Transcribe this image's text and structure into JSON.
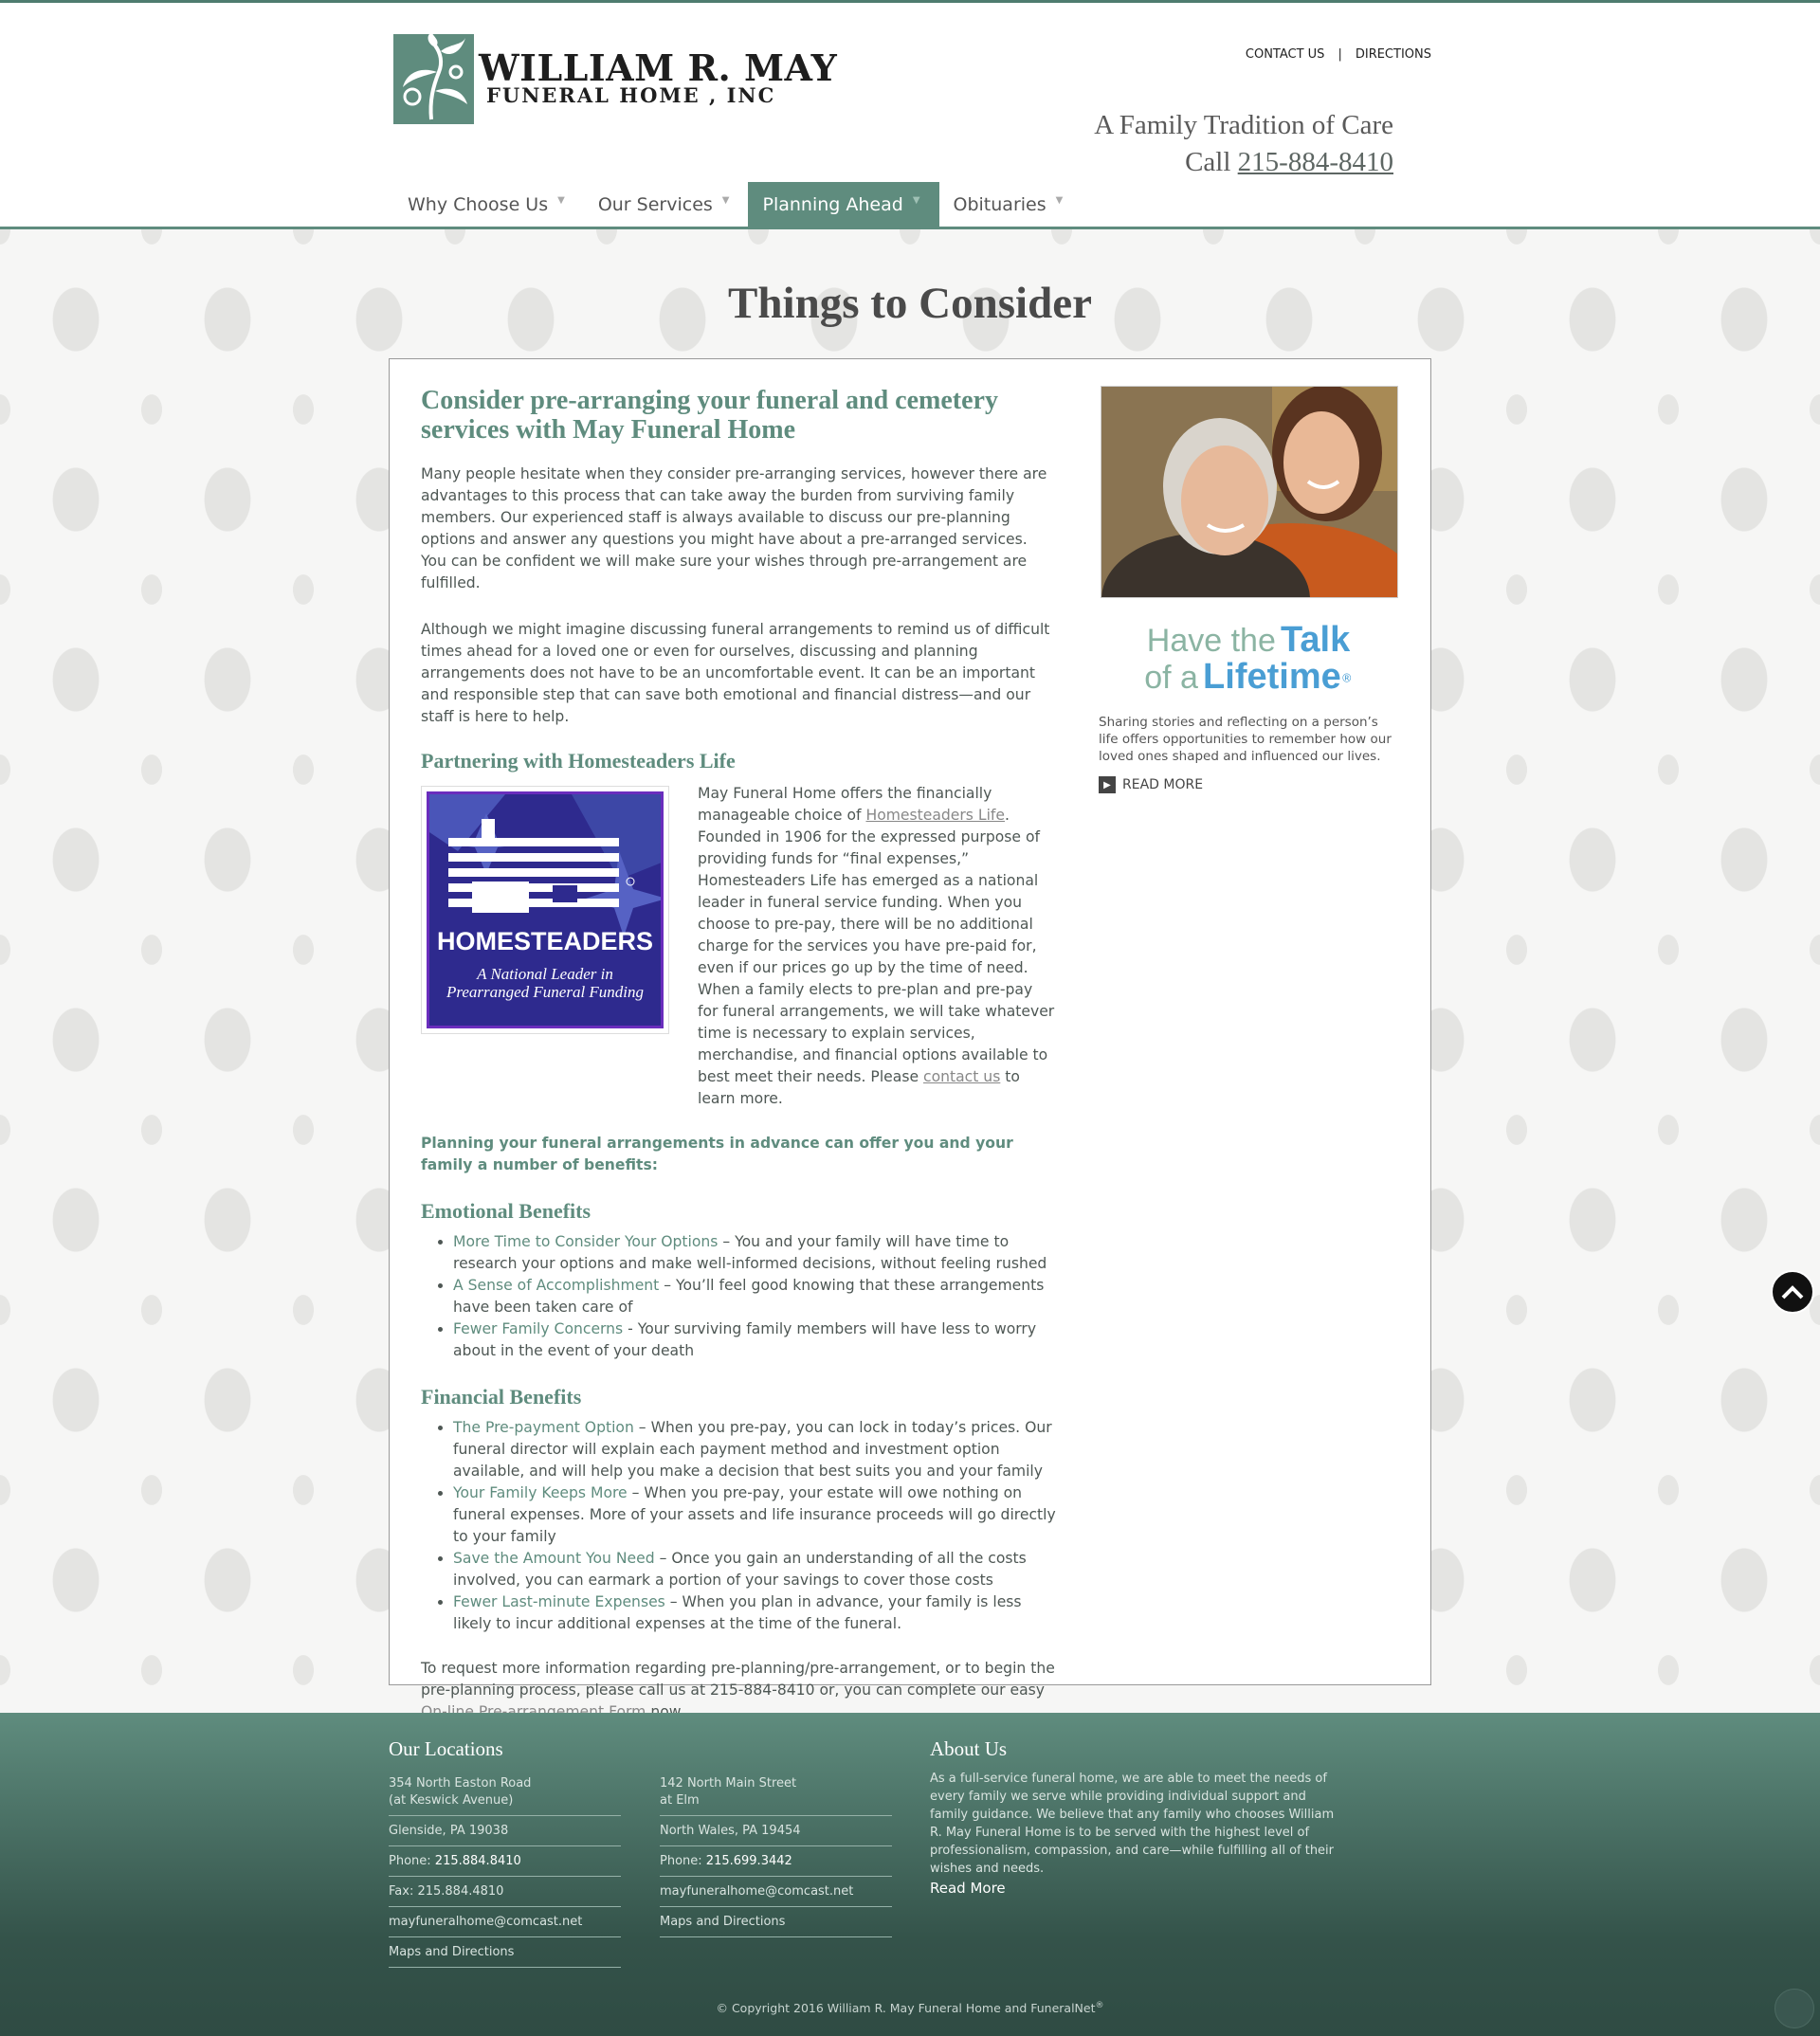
{
  "header": {
    "logo_line1": "WILLIAM R. MAY",
    "logo_line2": "FUNERAL HOME , INC",
    "toplinks": [
      "CONTACT US",
      "DIRECTIONS"
    ],
    "toplink_separator": "|",
    "tagline": "A Family Tradition of Care",
    "call_label": "Call",
    "phone": "215-884-8410"
  },
  "nav": {
    "items": [
      {
        "label": "Why Choose Us",
        "active": false
      },
      {
        "label": "Our Services",
        "active": false
      },
      {
        "label": "Planning Ahead",
        "active": true
      },
      {
        "label": "Obituaries",
        "active": false
      }
    ],
    "caret": "▼"
  },
  "page_title": "Things to Consider",
  "main": {
    "heading": "Consider pre-arranging your funeral and cemetery services with May Funeral Home",
    "para1": "Many people hesitate when they consider pre-arranging services, however there are advantages to this process that can take away the burden from surviving family members. Our experienced staff is always available to discuss our pre-planning options and answer any questions you might have about a pre-arranged services. You can be confident we will make sure your wishes through pre-arrangement are fulfilled.",
    "para2": "Although we might imagine discussing funeral arrangements to remind us of difficult times ahead for a loved one or even for ourselves, discussing and planning arrangements does not have to be an uncomfortable event. It can be an important and responsible step that can save both emotional and financial distress—and our staff is here to help.",
    "partner_heading": "Partnering with Homesteaders Life",
    "homesteaders_logo_name": "HOMESTEADERS",
    "homesteaders_logo_tag1": "A National Leader in",
    "homesteaders_logo_tag2": "Prearranged Funeral Funding",
    "partner_text_1": "May Funeral Home offers the financially manageable choice of ",
    "partner_link": "Homesteaders Life",
    "partner_text_2": ". Founded in 1906 for the expressed purpose of providing funds for “final expenses,” Homesteaders Life has emerged as a national leader in funeral service funding.  When you choose to pre-pay, there will be no additional charge for the services you have pre-paid for, even if our prices go up by the time of need. When a family elects to pre-plan and pre-pay for funeral arrangements, we will take whatever time is necessary to explain services, merchandise, and financial options available to best meet their needs. Please ",
    "partner_contact_link": "contact us",
    "partner_text_3": " to learn more.",
    "lead": "Planning your funeral arrangements in advance can offer you and your family a number of benefits:",
    "emotional_heading": "Emotional Benefits",
    "emotional": [
      {
        "title": "More Time to Consider Your Options",
        "sep": " – ",
        "text": "You and your family will have time to research your options and make well-informed decisions, without feeling rushed"
      },
      {
        "title": "A Sense of Accomplishment",
        "sep": " – ",
        "text": "You’ll feel good knowing that these arrangements have been taken care of"
      },
      {
        "title": "Fewer Family Concerns",
        "sep": " - ",
        "text": "Your surviving family members will have less to worry about in the event of your death"
      }
    ],
    "financial_heading": "Financial Benefits",
    "financial": [
      {
        "title": "The Pre-payment Option",
        "sep": " – ",
        "text": "When you pre-pay, you can lock in today’s prices. Our funeral director will explain each payment method and investment option available, and will help you make a decision that best suits you and your family"
      },
      {
        "title": "Your Family Keeps More",
        "sep": " – ",
        "text": "When you pre-pay, your estate will owe nothing on funeral expenses. More of your assets and life insurance proceeds will go directly to your family"
      },
      {
        "title": "Save the Amount You Need",
        "sep": " – ",
        "text": "Once you gain an understanding of all the costs involved, you can earmark a portion of your savings to cover those costs"
      },
      {
        "title": "Fewer Last-minute Expenses",
        "sep": " – ",
        "text": "When you plan in advance, your family is less likely to incur additional expenses at the time of the funeral."
      }
    ],
    "closing_1": "To request more information regarding pre-planning/pre-arrangement, or to begin the pre-planning process, please call us at 215-884-8410 or, you can complete our easy ",
    "closing_link": "On-line Pre-arrangement Form",
    "closing_2": " now."
  },
  "sidebar": {
    "talk_have": "Have the",
    "talk_talk": "Talk",
    "talk_of": "of a",
    "talk_lifetime": "Lifetime",
    "talk_reg": "®",
    "text": "Sharing stories and reflecting on a person’s life offers opportunities to remember how our loved ones shaped and influenced our lives.",
    "read_more": "READ MORE"
  },
  "footer": {
    "locations_heading": "Our Locations",
    "loc1": {
      "addr1": "354 North Easton Road",
      "addr2": "(at Keswick Avenue)",
      "city": "Glenside, PA 19038",
      "phone_label": "Phone: ",
      "phone": "215.884.8410",
      "fax": "Fax: 215.884.4810",
      "email": "mayfuneralhome@comcast.net",
      "maps": "Maps and Directions"
    },
    "loc2": {
      "addr1": "142 North Main Street",
      "addr2": "at Elm",
      "city": "North Wales, PA 19454",
      "phone_label": "Phone: ",
      "phone": "215.699.3442",
      "email": "mayfuneralhome@comcast.net",
      "maps": "Maps and Directions"
    },
    "about_heading": "About Us",
    "about_text": "As a full-service funeral home, we are able to meet the needs of every family we serve while providing individual support and family guidance. We believe that any family who chooses William R. May Funeral Home is to be served with the highest level of professionalism, compassion, and care—while fulfilling all of their wishes and needs.",
    "about_read_more": "Read More",
    "copyright": "© Copyright 2016 William R. May Funeral Home and FuneralNet",
    "copyright_reg": "®"
  },
  "colors": {
    "brand_green": "#5f8c7e",
    "footer_dark": "#2f4b43"
  },
  "icons": [
    "lily-logo-icon",
    "caret-down-icon",
    "arrow-right-icon",
    "chevron-up-icon"
  ]
}
